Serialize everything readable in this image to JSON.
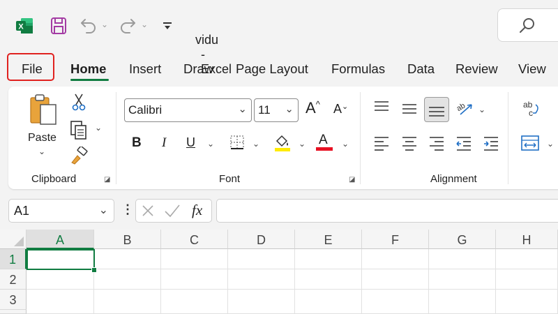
{
  "titlebar": {
    "file_name": "vidu",
    "separator": "-",
    "app_name": "Excel"
  },
  "tabs": [
    "File",
    "Home",
    "Insert",
    "Draw",
    "Page Layout",
    "Formulas",
    "Data",
    "Review",
    "View"
  ],
  "active_tab": "Home",
  "ribbon": {
    "clipboard": {
      "paste_label": "Paste",
      "group_label": "Clipboard"
    },
    "font": {
      "font_name": "Calibri",
      "font_size": "11",
      "bold": "B",
      "italic": "I",
      "underline": "U",
      "grow": "A",
      "shrink": "A",
      "font_color_letter": "A",
      "group_label": "Font",
      "highlight_color": "#ffeb00",
      "font_color": "#e81123"
    },
    "alignment": {
      "group_label": "Alignment"
    },
    "wrap_icon_text": "ab\nc"
  },
  "formula_bar": {
    "name_box": "A1",
    "fx": "fx",
    "formula": ""
  },
  "grid": {
    "columns": [
      "A",
      "B",
      "C",
      "D",
      "E",
      "F",
      "G",
      "H"
    ],
    "rows": [
      "1",
      "2",
      "3"
    ],
    "selected_cell": "A1"
  },
  "colors": {
    "accent": "#107c41",
    "highlight_border": "#e0211f",
    "excel_icon": "#107c41",
    "save_icon": "#a33aa3"
  }
}
